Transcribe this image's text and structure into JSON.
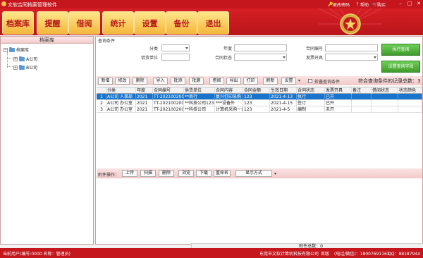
{
  "window": {
    "title": "文软合同档案管理软件",
    "links": [
      {
        "icon": "key-icon",
        "label": "更改密码"
      },
      {
        "icon": "help-icon",
        "label": "帮助"
      },
      {
        "icon": "cart-icon",
        "label": "购买"
      }
    ]
  },
  "toolbar": {
    "buttons": [
      "档案库",
      "提醒",
      "借阅",
      "统计",
      "设置",
      "备份",
      "退出"
    ]
  },
  "tree": {
    "header": "档案库",
    "root": "档案库",
    "children": [
      "A公司",
      "B公司"
    ]
  },
  "query": {
    "title": "查询条件",
    "labels": {
      "category": "分类",
      "year": "年度",
      "contract_no": "合同编号",
      "supplier": "供货单位",
      "status": "合同状态",
      "invoice": "发票开具"
    },
    "run_label": "执行查询",
    "fields_label": "设置查询字段"
  },
  "actions": {
    "buttons": [
      "新增",
      "修改",
      "删除",
      "导入",
      "批添",
      "批删",
      "借阅",
      "导出",
      "打印",
      "刷新",
      "设置"
    ],
    "fold_label": "折叠查询条件",
    "count_text": "符合查询条件的记录总数：3"
  },
  "grid": {
    "columns": [
      "分类",
      "年度",
      "合同编号",
      "供货单位",
      "合同内容",
      "合同金额",
      "生效日期",
      "合同状态",
      "发票开具",
      "备注",
      "借阅状态",
      "状态颜色"
    ],
    "rows": [
      {
        "no": "1",
        "cells": [
          "A公司 人事部",
          "2021",
          "TT-2021002002",
          "**商行",
          "复兴打印采购",
          "123",
          "2021-4-13",
          "执行",
          "已开",
          "",
          "",
          ""
        ]
      },
      {
        "no": "2",
        "cells": [
          "A公司 办公室",
          "2021",
          "TT-2021002001",
          "**科技公司123",
          "***设备外",
          "123",
          "2021-4-15",
          "签订",
          "已开",
          "",
          "",
          ""
        ]
      },
      {
        "no": "3",
        "cells": [
          "A公司 办公室",
          "2021",
          "TT-2021002001",
          "**科技公司",
          "计算机采购一台",
          "123",
          "2021-4-5",
          "编制",
          "未开",
          "",
          "",
          ""
        ]
      }
    ]
  },
  "attach": {
    "label": "附件操作：",
    "buttons": [
      "上传",
      "扫描",
      "删除",
      "浏览",
      "下载",
      "重命名"
    ],
    "display_label": "显示方式",
    "total": "附件总数：0"
  },
  "status": {
    "user": "当前用户(编号:0000 名称：管理员)",
    "company": "东莞市文软计算机科技有限公司",
    "site": "首版",
    "phone": "(电话/微信)：18007691163",
    "qq": "QQ：88187944"
  },
  "colors": {
    "brand_red": "#c4161c",
    "button_gold": "#f4b73c",
    "query_green": "#3f9b2b",
    "selection_blue": "#1874cd"
  }
}
